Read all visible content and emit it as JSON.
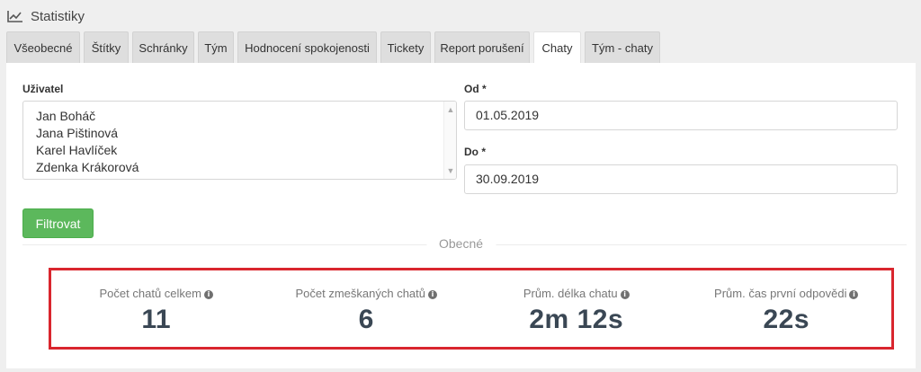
{
  "header": {
    "title": "Statistiky",
    "icon": "line-chart-icon"
  },
  "tabs": [
    {
      "label": "Všeobecné",
      "active": false
    },
    {
      "label": "Štítky",
      "active": false
    },
    {
      "label": "Schránky",
      "active": false
    },
    {
      "label": "Tým",
      "active": false
    },
    {
      "label": "Hodnocení spokojenosti",
      "active": false
    },
    {
      "label": "Tickety",
      "active": false
    },
    {
      "label": "Report porušení",
      "active": false
    },
    {
      "label": "Chaty",
      "active": true
    },
    {
      "label": "Tým - chaty",
      "active": false
    }
  ],
  "filters": {
    "user_label": "Uživatel",
    "users": [
      "Jan Boháč",
      "Jana Pištinová",
      "Karel Havlíček",
      "Zdenka Krákorová"
    ],
    "from_label": "Od *",
    "from_value": "01.05.2019",
    "to_label": "Do *",
    "to_value": "30.09.2019",
    "filter_button": "Filtrovat"
  },
  "section": {
    "title": "Obecné"
  },
  "stats": [
    {
      "label": "Počet chatů celkem",
      "value": "11"
    },
    {
      "label": "Počet zmeškaných chatů",
      "value": "6"
    },
    {
      "label": "Prům. délka chatu",
      "value": "2m 12s"
    },
    {
      "label": "Prům. čas první odpovědi",
      "value": "22s"
    }
  ],
  "colors": {
    "accent_green": "#5cb85c",
    "highlight_red": "#d9262e",
    "value_text": "#3a4754"
  }
}
